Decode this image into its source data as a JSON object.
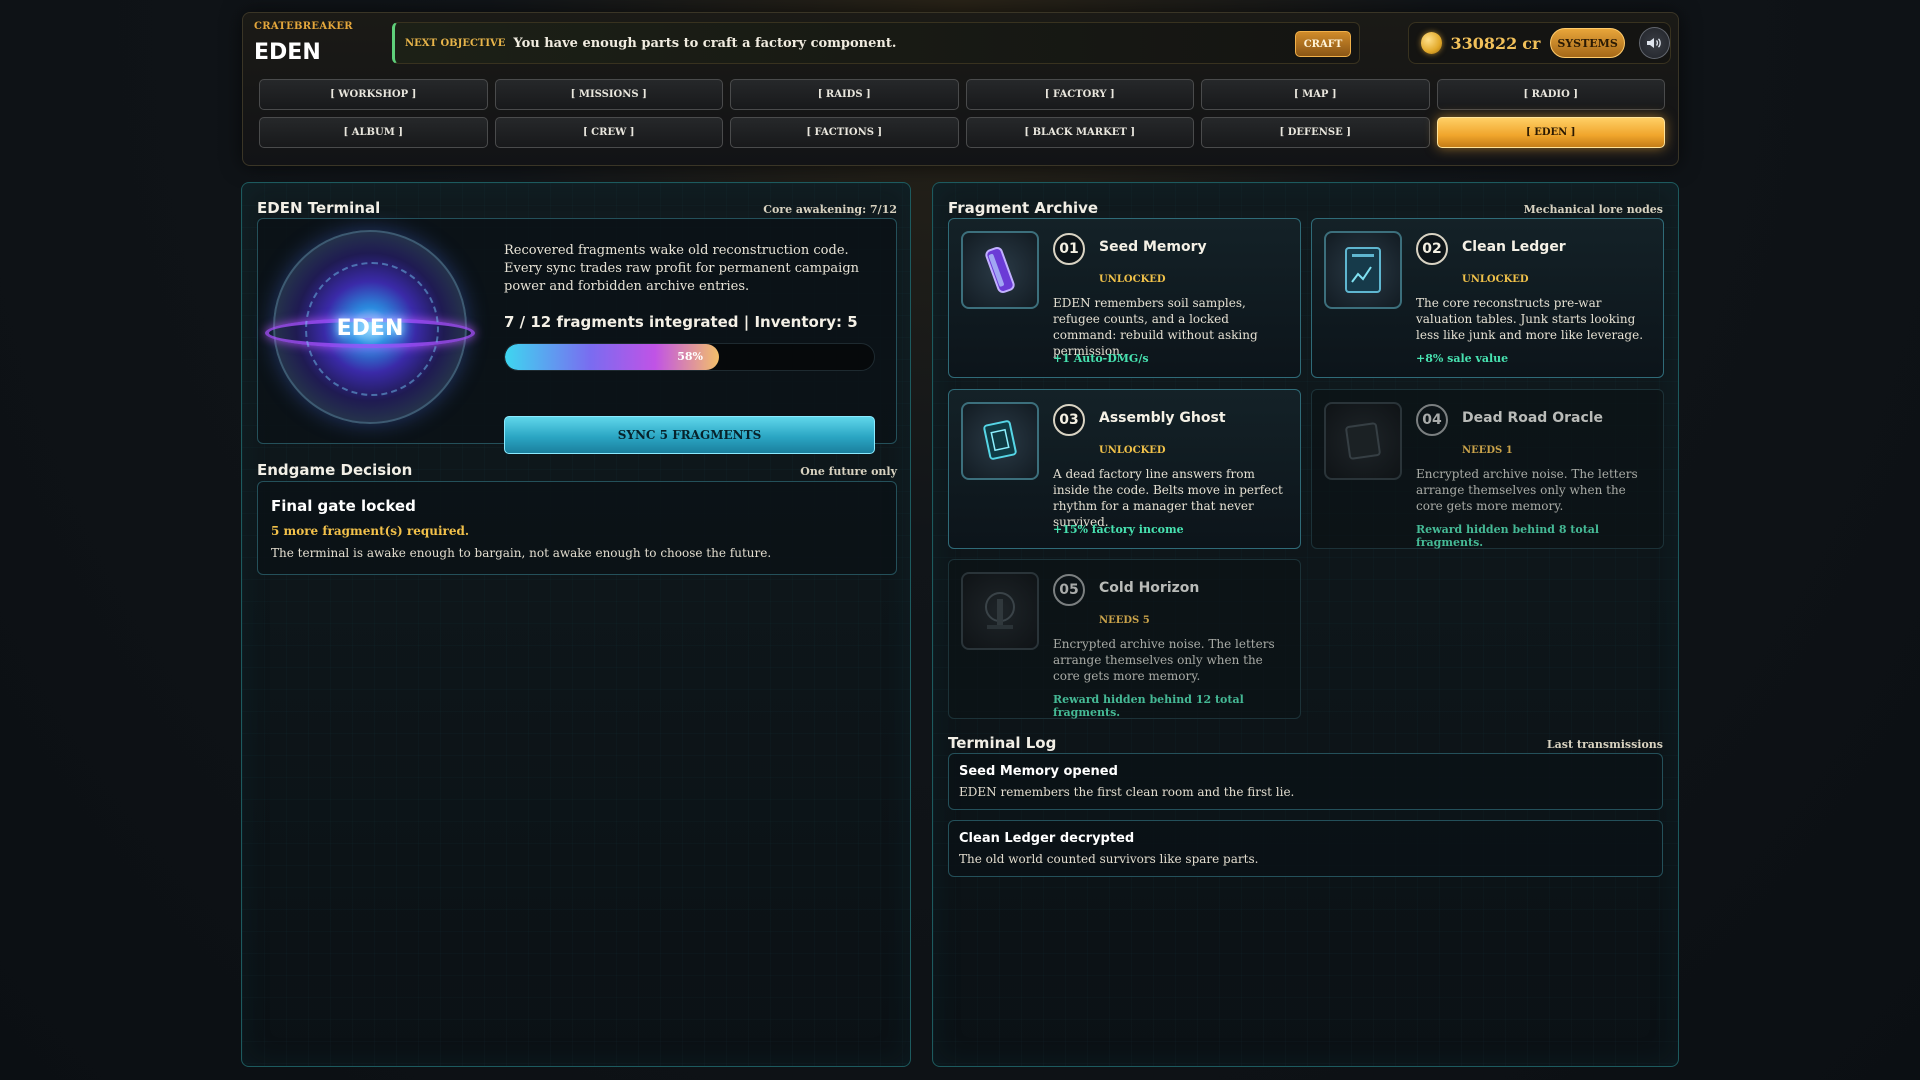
{
  "brand": {
    "subtitle": "CRATEBREAKER",
    "title": "EDEN"
  },
  "objective": {
    "label": "NEXT OBJECTIVE",
    "text": "You have enough parts to craft a factory component.",
    "craft_label": "CRAFT"
  },
  "wallet": {
    "credits": "330822",
    "unit": "cr",
    "systems_label": "SYSTEMS",
    "coin_icon": "coin-icon",
    "sound_icon": "speaker-icon"
  },
  "nav": {
    "row1": [
      "[ WORKSHOP ]",
      "[ MISSIONS ]",
      "[ RAIDS ]",
      "[ FACTORY ]",
      "[ MAP ]",
      "[ RADIO ]"
    ],
    "row2": [
      "[ ALBUM ]",
      "[ CREW ]",
      "[ FACTIONS ]",
      "[ BLACK MARKET ]",
      "[ DEFENSE ]",
      "[ EDEN ]"
    ],
    "active": "[ EDEN ]"
  },
  "terminal": {
    "title": "EDEN Terminal",
    "meta": "Core awakening: 7/12",
    "orb_label": "EDEN",
    "description": "Recovered fragments wake old reconstruction code. Every sync trades raw profit for permanent campaign power and forbidden archive entries.",
    "stat": "7 / 12 fragments integrated | Inventory: 5",
    "progress": 0.58,
    "progress_label": "58%",
    "sync_label": "SYNC 5 FRAGMENTS"
  },
  "decision": {
    "title": "Endgame Decision",
    "meta": "One future only",
    "card_title": "Final gate locked",
    "warning": "5 more fragment(s) required.",
    "note": "The terminal is awake enough to bargain, not awake enough to choose the future."
  },
  "archive": {
    "title": "Fragment Archive",
    "meta": "Mechanical lore nodes",
    "fragments": [
      {
        "num": "01",
        "name": "Seed Memory",
        "status": "UNLOCKED",
        "desc": "EDEN remembers soil samples, refugee counts, and a locked command: rebuild without asking permission.",
        "reward": "+1 Auto-DMG/s",
        "icon": "vial-icon"
      },
      {
        "num": "02",
        "name": "Clean Ledger",
        "status": "UNLOCKED",
        "desc": "The core reconstructs pre-war valuation tables. Junk starts looking less like junk and more like leverage.",
        "reward": "+8% sale value",
        "icon": "ledger-icon"
      },
      {
        "num": "03",
        "name": "Assembly Ghost",
        "status": "UNLOCKED",
        "desc": "A dead factory line answers from inside the code. Belts move in perfect rhythm for a manager that never survived.",
        "reward": "+15% factory income",
        "icon": "hologram-icon"
      },
      {
        "num": "04",
        "name": "Dead Road Oracle",
        "status": "NEEDS 1",
        "desc": "Encrypted archive noise. The letters arrange themselves only when the core gets more memory.",
        "reward": "Reward hidden behind 8 total fragments.",
        "icon": "locked-tablet-icon"
      },
      {
        "num": "05",
        "name": "Cold Horizon",
        "status": "NEEDS 5",
        "desc": "Encrypted archive noise. The letters arrange themselves only when the core gets more memory.",
        "reward": "Reward hidden behind 12 total fragments.",
        "icon": "locked-gate-icon"
      }
    ]
  },
  "log": {
    "title": "Terminal Log",
    "meta": "Last transmissions",
    "entries": [
      {
        "title": "Seed Memory opened",
        "text": "EDEN remembers the first clean room and the first lie."
      },
      {
        "title": "Clean Ledger decrypted",
        "text": "The old world counted survivors like spare parts."
      }
    ]
  },
  "colors": {
    "accent_gold": "#f0a52c",
    "accent_cyan": "#2ba6c4",
    "reward_green": "#47e2b0",
    "status_yellow": "#f0c149"
  }
}
